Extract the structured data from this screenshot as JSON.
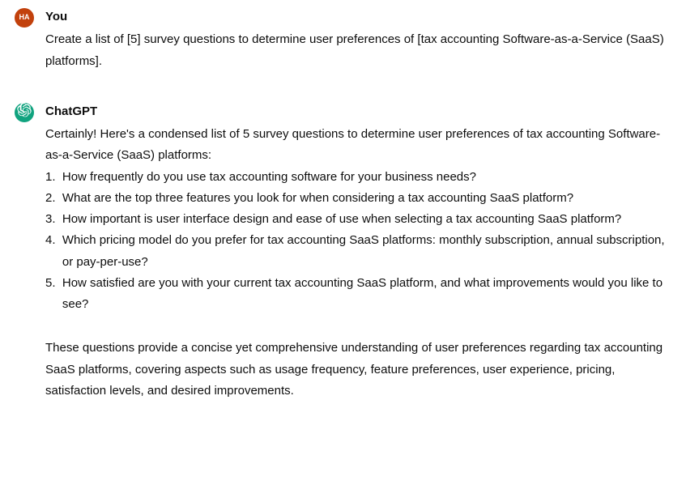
{
  "user": {
    "avatar_text": "HA",
    "sender": "You",
    "message": "Create a list of [5] survey questions to determine user preferences of [tax accounting Software-as-a-Service (SaaS) platforms]."
  },
  "assistant": {
    "sender": "ChatGPT",
    "intro": "Certainly! Here's a condensed list of 5 survey questions to determine user preferences of tax accounting Software-as-a-Service (SaaS) platforms:",
    "list": [
      {
        "num": "1.  ",
        "text": "How frequently do you use tax accounting software for your business needs?"
      },
      {
        "num": "2.  ",
        "text": "What are the top three features you look for when considering a tax accounting SaaS platform?"
      },
      {
        "num": "3.  ",
        "text": "How important is user interface design and ease of use when selecting a tax accounting SaaS platform?"
      },
      {
        "num": "4.  ",
        "text": "Which pricing model do you prefer for tax accounting SaaS platforms: monthly subscription, annual subscription, or pay-per-use?"
      },
      {
        "num": "5.  ",
        "text": "How satisfied are you with your current tax accounting SaaS platform, and what improvements would you like to see?"
      }
    ],
    "outro": "These questions provide a concise yet comprehensive understanding of user preferences regarding tax accounting SaaS platforms, covering aspects such as usage frequency, feature preferences, user experience, pricing, satisfaction levels, and desired improvements."
  }
}
